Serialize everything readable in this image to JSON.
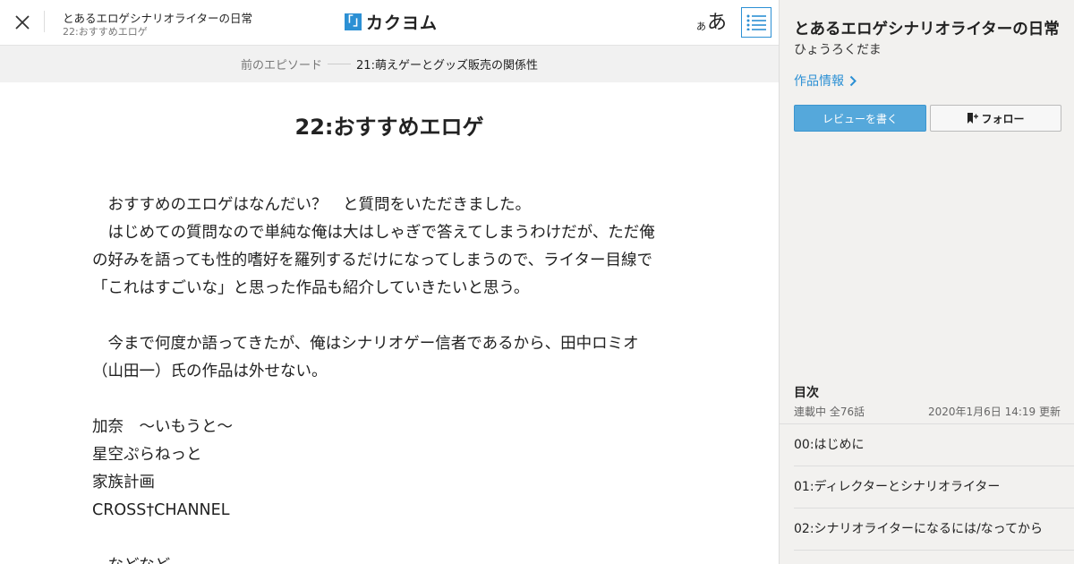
{
  "header": {
    "work_title": "とあるエロゲシナリオライターの日常",
    "episode_subtitle": "22:おすすめエロゲ",
    "logo_mark": "「」",
    "logo_text": "カクヨム",
    "font_size_small": "あ",
    "font_size_large": "あ"
  },
  "prev_episode": {
    "label": "前のエピソード",
    "title": "21:萌えゲーとグッズ販売の関係性"
  },
  "episode": {
    "title": "22:おすすめエロゲ",
    "paragraphs": [
      "　おすすめのエロゲはなんだい？　と質問をいただきました。",
      "　はじめての質問なので単純な俺は大はしゃぎで答えてしまうわけだが、ただ俺",
      "の好みを語っても性的嗜好を羅列するだけになってしまうので、ライター目線で",
      "「これはすごいな」と思った作品も紹介していきたいと思う。",
      "",
      "　今まで何度か語ってきたが、俺はシナリオゲー信者であるから、田中ロミオ",
      "（山田一）氏の作品は外せない。",
      "",
      "加奈　～いもうと～",
      "星空ぷらねっと",
      "家族計画",
      "CROSS†CHANNEL",
      "",
      "　などなど"
    ]
  },
  "sidebar": {
    "work_title": "とあるエロゲシナリオライターの日常",
    "author": "ひょうろくだま",
    "info_link": "作品情報",
    "review_button": "レビューを書く",
    "follow_button": "フォロー",
    "toc_heading": "目次",
    "toc_status": "連載中 全76話",
    "toc_updated": "2020年1月6日 14:19 更新",
    "toc_items": [
      "00:はじめに",
      "01:ディレクターとシナリオライター",
      "02:シナリオライターになるには/なってから"
    ]
  },
  "colors": {
    "accent": "#2c90d4",
    "review_button_bg": "#55a8db",
    "sidebar_bg": "#f2f1ef",
    "prevbar_bg": "#f1f1f1"
  },
  "icons": {
    "close": "close-icon",
    "toc": "list-icon",
    "info_chevron": "chevron-right-icon",
    "follow": "bookmark-plus-icon"
  }
}
